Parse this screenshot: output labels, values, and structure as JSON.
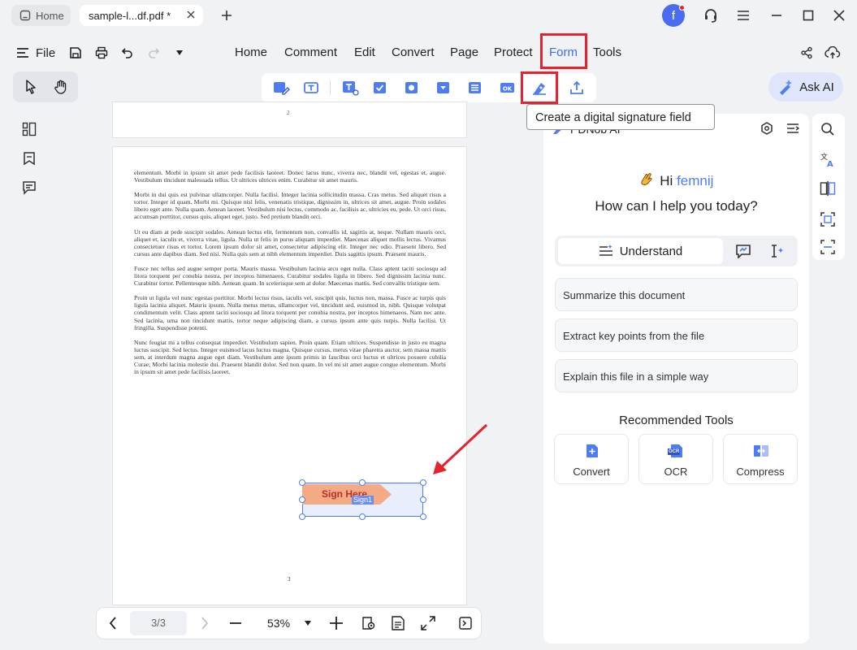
{
  "tabs": {
    "home": "Home",
    "doc": "sample-l...df.pdf *"
  },
  "user": {
    "avatar_letter": "f"
  },
  "menu": {
    "file": "File",
    "items": [
      "Home",
      "Comment",
      "Edit",
      "Convert",
      "Page",
      "Protect",
      "Form",
      "Tools"
    ],
    "active": "Form"
  },
  "ask_ai": "Ask AI",
  "tooltip": "Create a digital signature field",
  "page_prev": {
    "number": "2"
  },
  "page": {
    "number": "3",
    "paragraphs": [
      "elementum. Morbi in ipsum sit amet pede facilisis laoreet. Donec lacus nunc, viverra nec, blandit vel, egestas et, augue. Vestibulum tincidunt malesuada tellus. Ut ultrices ultrices enim. Curabitur sit amet mauris.",
      "Morbi in dui quis est pulvinar ullamcorper. Nulla facilisi. Integer lacinia sollicitudin massa. Cras metus. Sed aliquet risus a tortor. Integer id quam. Morbi mi. Quisque nisl felis, venenatis tristique, dignissim in, ultrices sit amet, augue. Proin sodales libero eget ante. Nulla quam. Aenean laoreet. Vestibulum nisi lectus, commodo ac, facilisis ac, ultricies eu, pede. Ut orci risus, accumsan porttitor, cursus quis, aliquet eget, justo. Sed pretium blandit orci.",
      "Ut eu diam at pede suscipit sodales. Aenean lectus elit, fermentum non, convallis id, sagittis at, neque. Nullam mauris orci, aliquet et, iaculis et, viverra vitae, ligula. Nulla ut felis in purus aliquam imperdiet. Maecenas aliquet mollis lectus. Vivamus consectetuer risus et tortor. Lorem ipsum dolor sit amet, consectetur adipiscing elit. Integer nec odio. Praesent libero. Sed cursus ante dapibus diam. Sed nisi. Nulla quis sem at nibh elementum imperdiet. Duis sagittis ipsum. Praesent mauris.",
      "Fusce nec tellus sed augue semper porta. Mauris massa. Vestibulum lacinia arcu eget nulla. Class aptent taciti sociosqu ad litora torquent per conubia nostra, per inceptos himenaeos. Curabitur sodales ligula in libero. Sed dignissim lacinia nunc. Curabitur tortor. Pellentesque nibh. Aenean quam. In scelerisque sem at dolor. Maecenas mattis. Sed convallis tristique sem.",
      "Proin ut ligula vel nunc egestas porttitor. Morbi lectus risus, iaculis vel, suscipit quis, luctus non, massa. Fusce ac turpis quis ligula lacinia aliquet. Mauris ipsum. Nulla metus metus, ullamcorper vel, tincidunt sed, euismod in, nibh. Quisque volutpat condimentum velit. Class aptent taciti sociosqu ad litora torquent per conubia nostra, per inceptos himenaeos. Nam nec ante. Sed lacinia, urna non tincidunt mattis, tortor neque adipiscing diam, a cursus ipsum ante quis turpis. Nulla facilisi. Ut fringilla. Suspendisse potenti.",
      "Nunc feugiat mi a tellus consequat imperdiet. Vestibulum sapien. Proin quam. Etiam ultrices. Suspendisse in justo eu magna luctus suscipit. Sed lectus. Integer euismod lacus luctus magna. Quisque cursus, metus vitae pharetra auctor, sem massa mattis sem, at interdum magna augue eget diam. Vestibulum ante ipsum primis in faucibus orci luctus et ultrices posuere cubilia Curae; Morbi lacinia molestie dui. Praesent blandit dolor. Sed non quam. In vel mi sit amet augue congue elementum. Morbi in ipsum sit amet pede facilisis laoreet."
    ],
    "sign_here": "Sign Here",
    "field_name": "Sign1"
  },
  "ai": {
    "title": "PDNob AI",
    "greeting_prefix": "Hi",
    "username": "femnij",
    "question": "How can I help you today?",
    "mode": "Understand",
    "suggestions": [
      "Summarize this document",
      "Extract key points from the file",
      "Explain this file in a simple way"
    ],
    "recommended_title": "Recommended Tools",
    "tools": [
      "Convert",
      "OCR",
      "Compress"
    ],
    "ocr_badge": "OCR"
  },
  "bottom": {
    "page_indicator": "3/3",
    "zoom": "53%"
  },
  "colors": {
    "accent": "#4d7cf4",
    "highlight": "#e5222e",
    "sign_fill": "#f5aa86",
    "sign_text": "#b5312a"
  }
}
